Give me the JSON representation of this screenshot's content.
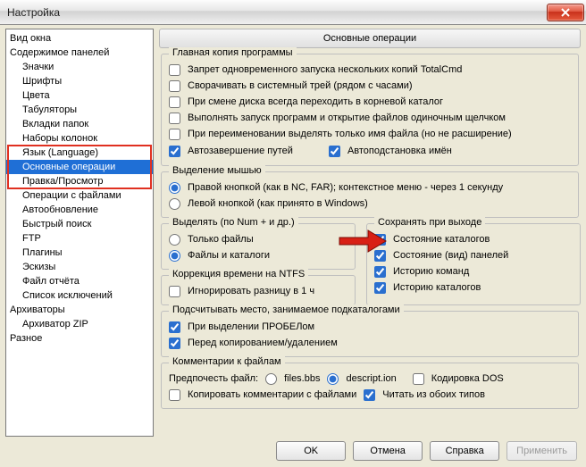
{
  "window": {
    "title": "Настройка"
  },
  "tree": {
    "items": [
      {
        "label": "Вид окна",
        "level": "root"
      },
      {
        "label": "Содержимое панелей",
        "level": "root"
      },
      {
        "label": "Значки",
        "level": "sub"
      },
      {
        "label": "Шрифты",
        "level": "sub"
      },
      {
        "label": "Цвета",
        "level": "sub"
      },
      {
        "label": "Табуляторы",
        "level": "sub"
      },
      {
        "label": "Вкладки папок",
        "level": "sub"
      },
      {
        "label": "Наборы колонок",
        "level": "sub"
      },
      {
        "label": "Язык (Language)",
        "level": "sub"
      },
      {
        "label": "Основные операции",
        "level": "sub",
        "selected": true
      },
      {
        "label": "Правка/Просмотр",
        "level": "sub"
      },
      {
        "label": "Операции с файлами",
        "level": "sub"
      },
      {
        "label": "Автообновление",
        "level": "sub"
      },
      {
        "label": "Быстрый поиск",
        "level": "sub"
      },
      {
        "label": "FTP",
        "level": "sub"
      },
      {
        "label": "Плагины",
        "level": "sub"
      },
      {
        "label": "Эскизы",
        "level": "sub"
      },
      {
        "label": "Файл отчёта",
        "level": "sub"
      },
      {
        "label": "Список исключений",
        "level": "sub"
      },
      {
        "label": "Архиваторы",
        "level": "root"
      },
      {
        "label": "Архиватор ZIP",
        "level": "sub"
      },
      {
        "label": "Разное",
        "level": "root"
      }
    ]
  },
  "panel": {
    "header": "Основные операции",
    "group_main": {
      "legend": "Главная копия программы",
      "items": [
        {
          "label": "Запрет одновременного запуска нескольких копий TotalCmd",
          "checked": false
        },
        {
          "label": "Сворачивать в системный трей (рядом с часами)",
          "checked": false
        },
        {
          "label": "При смене диска всегда переходить в корневой каталог",
          "checked": false
        },
        {
          "label": "Выполнять запуск программ и открытие файлов одиночным щелчком",
          "checked": false
        },
        {
          "label": "При переименовании выделять только имя файла (но не расширение)",
          "checked": false
        }
      ],
      "pair": [
        {
          "label": "Автозавершение путей",
          "checked": true
        },
        {
          "label": "Автоподстановка имён",
          "checked": true
        }
      ]
    },
    "group_mouse": {
      "legend": "Выделение мышью",
      "options": [
        {
          "label": "Правой кнопкой (как в NC, FAR); контекстное меню - через 1 секунду",
          "checked": true
        },
        {
          "label": "Левой кнопкой (как принято в Windows)",
          "checked": false
        }
      ]
    },
    "group_select": {
      "legend": "Выделять (по Num + и др.)",
      "options": [
        {
          "label": "Только файлы",
          "checked": false
        },
        {
          "label": "Файлы и каталоги",
          "checked": true
        }
      ]
    },
    "group_save": {
      "legend": "Сохранять при выходе",
      "items": [
        {
          "label": "Состояние каталогов",
          "checked": true
        },
        {
          "label": "Состояние (вид) панелей",
          "checked": true
        },
        {
          "label": "Историю команд",
          "checked": true
        },
        {
          "label": "Историю каталогов",
          "checked": true
        }
      ]
    },
    "group_ntfs": {
      "legend": "Коррекция времени на NTFS",
      "items": [
        {
          "label": "Игнорировать разницу в 1 ч",
          "checked": false
        }
      ]
    },
    "group_subdir": {
      "legend": "Подсчитывать место, занимаемое подкаталогами",
      "items": [
        {
          "label": "При выделении ПРОБЕЛом",
          "checked": true
        },
        {
          "label": "Перед копированием/удалением",
          "checked": true
        }
      ]
    },
    "group_comments": {
      "legend": "Комментарии к файлам",
      "prefer_label": "Предпочесть файл:",
      "radio": [
        {
          "label": "files.bbs",
          "checked": false
        },
        {
          "label": "descript.ion",
          "checked": true
        }
      ],
      "dos_label": "Кодировка DOS",
      "dos_checked": false,
      "row2": [
        {
          "label": "Копировать комментарии с файлами",
          "checked": false
        },
        {
          "label": "Читать из обоих типов",
          "checked": true
        }
      ]
    }
  },
  "footer": {
    "ok": "OK",
    "cancel": "Отмена",
    "help": "Справка",
    "apply": "Применить"
  }
}
